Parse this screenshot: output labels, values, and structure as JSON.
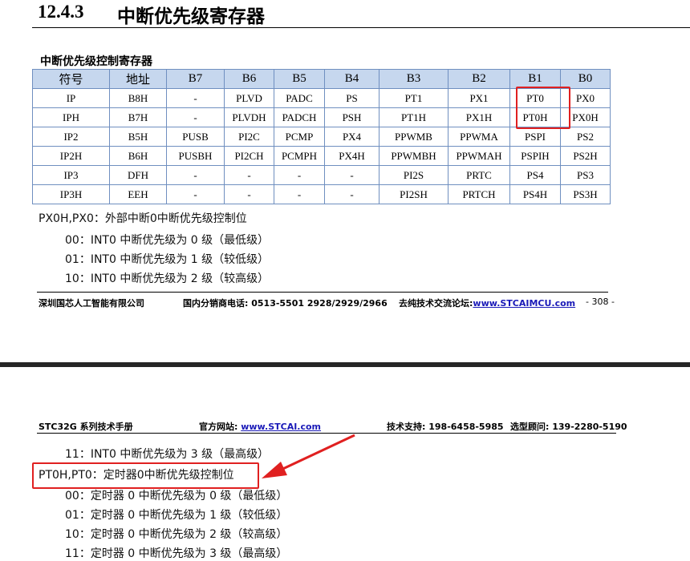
{
  "section": {
    "number": "12.4.3",
    "title": "中断优先级寄存器"
  },
  "table": {
    "title": "中断优先级控制寄存器",
    "headers": [
      "符号",
      "地址",
      "B7",
      "B6",
      "B5",
      "B4",
      "B3",
      "B2",
      "B1",
      "B0"
    ],
    "rows": [
      [
        "IP",
        "B8H",
        "-",
        "PLVD",
        "PADC",
        "PS",
        "PT1",
        "PX1",
        "PT0",
        "PX0"
      ],
      [
        "IPH",
        "B7H",
        "-",
        "PLVDH",
        "PADCH",
        "PSH",
        "PT1H",
        "PX1H",
        "PT0H",
        "PX0H"
      ],
      [
        "IP2",
        "B5H",
        "PUSB",
        "PI2C",
        "PCMP",
        "PX4",
        "PPWMB",
        "PPWMA",
        "PSPI",
        "PS2"
      ],
      [
        "IP2H",
        "B6H",
        "PUSBH",
        "PI2CH",
        "PCMPH",
        "PX4H",
        "PPWMBH",
        "PPWMAH",
        "PSPIH",
        "PS2H"
      ],
      [
        "IP3",
        "DFH",
        "-",
        "-",
        "-",
        "-",
        "PI2S",
        "PRTC",
        "PS4",
        "PS3"
      ],
      [
        "IP3H",
        "EEH",
        "-",
        "-",
        "-",
        "-",
        "PI2SH",
        "PRTCH",
        "PS4H",
        "PS3H"
      ]
    ]
  },
  "px0": {
    "heading": "PX0H,PX0：外部中断0中断优先级控制位",
    "items": [
      "00：INT0 中断优先级为 0 级（最低级）",
      "01：INT0 中断优先级为 1 级（较低级）",
      "10：INT0 中断优先级为 2 级（较高级）",
      "11：INT0 中断优先级为 3 级（最高级）"
    ]
  },
  "footer1": {
    "company": "深圳国芯人工智能有限公司",
    "phone": "国内分销商电话: 0513-5501 2928/2929/2966",
    "forum_label": "去纯技术交流论坛:",
    "forum_url": "www.STCAIMCU.com",
    "page": "- 308 -"
  },
  "header2": {
    "manual": "STC32G 系列技术手册",
    "site_label": "官方网站: ",
    "site_url": "www.STCAI.com",
    "support": "技术支持: 198-6458-5985",
    "advisor": "选型顾问: 139-2280-5190"
  },
  "pt0": {
    "heading": "PT0H,PT0：定时器0中断优先级控制位",
    "items": [
      "00：定时器 0 中断优先级为 0 级（最低级）",
      "01：定时器 0 中断优先级为 1 级（较低级）",
      "10：定时器 0 中断优先级为 2 级（较高级）",
      "11：定时器 0 中断优先级为 3 级（最高级）"
    ]
  },
  "colors": {
    "annotation": "#e02020",
    "table_header_bg": "#c6d7ee",
    "table_border": "#6f8fc0",
    "link": "#1a1ab8"
  }
}
